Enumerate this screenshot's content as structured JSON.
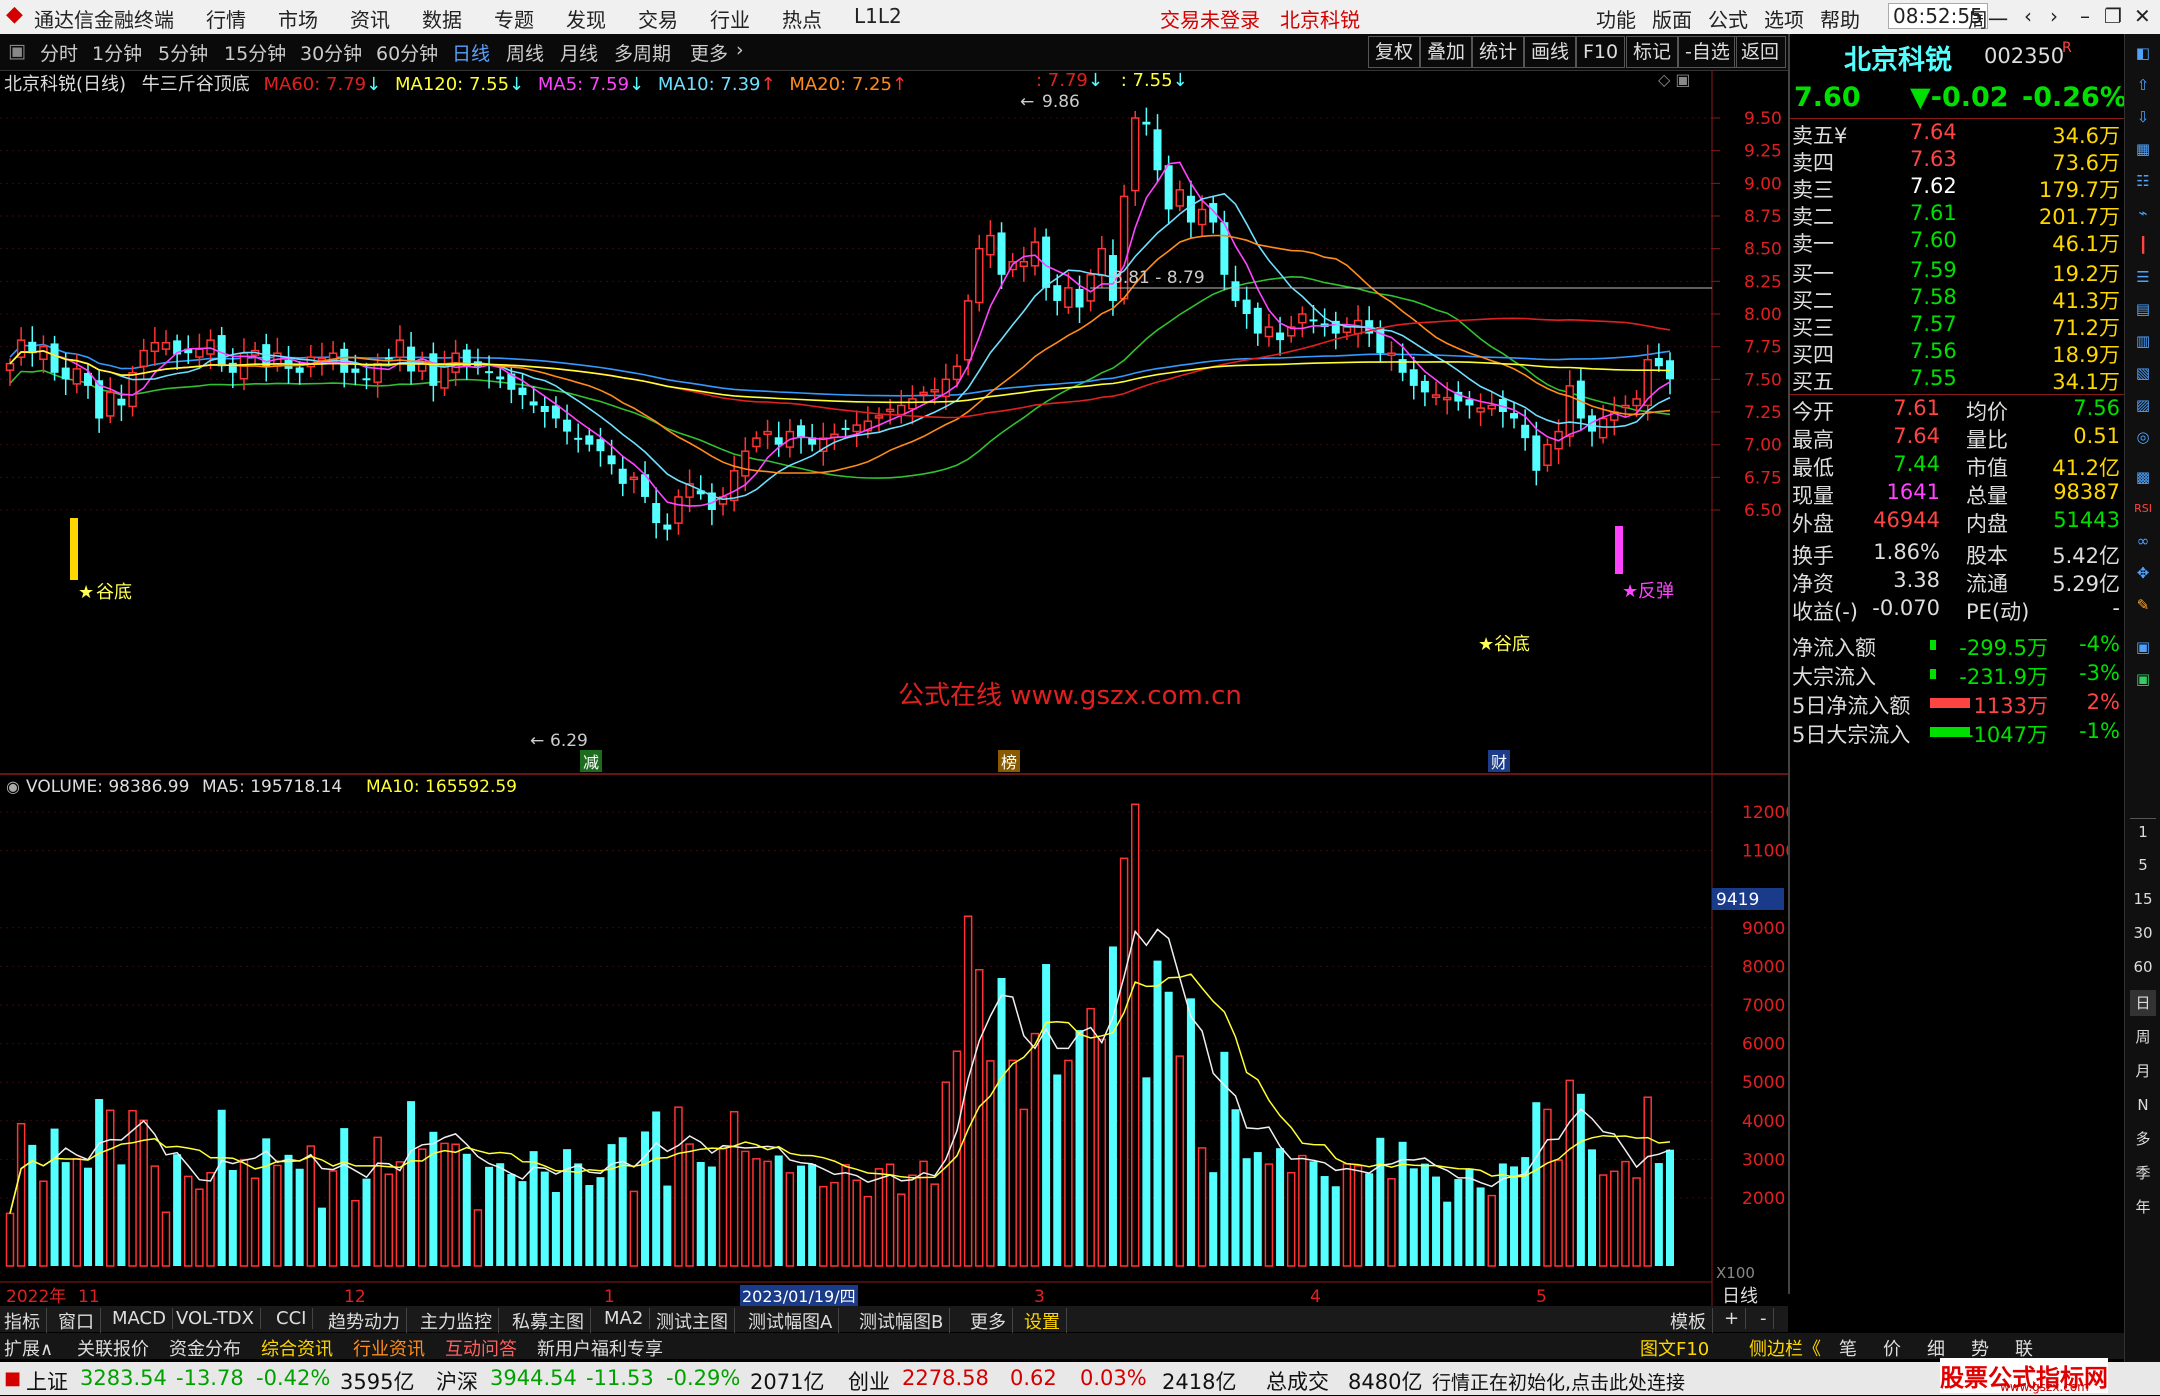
{
  "menu": {
    "app_title": "通达信金融终端",
    "items": [
      "行情",
      "市场",
      "资讯",
      "数据",
      "专题",
      "发现",
      "交易",
      "行业",
      "热点",
      "L1L2"
    ],
    "login_status": "交易未登录",
    "stock_title": "北京科锐",
    "right_items": [
      "功能",
      "版面",
      "公式",
      "选项",
      "帮助"
    ],
    "time": "08:52:55",
    "weekday": "周一"
  },
  "toolbar": {
    "periods": [
      "分时",
      "1分钟",
      "5分钟",
      "15分钟",
      "30分钟",
      "60分钟",
      "日线",
      "周线",
      "月线",
      "多周期",
      "更多"
    ],
    "selected": "日线",
    "actions": [
      "复权",
      "叠加",
      "统计",
      "画线",
      "F10",
      "标记",
      "-自选",
      "返回"
    ]
  },
  "chart_header": {
    "name": "北京科锐(日线)",
    "formula": "牛三斤谷顶底",
    "ma60": "MA60: 7.79",
    "ma120": "MA120: 7.55",
    "ma5": "MA5: 7.59",
    "ma10": "MA10: 7.39",
    "ma20": "MA20: 7.25",
    "top_a": ": 7.79",
    "top_b": ": 7.55"
  },
  "volume_header": {
    "volume": "VOLUME: 98386.99",
    "ma5": "MA5: 195718.14",
    "ma10": "MA10: 165592.59"
  },
  "chart_labels": {
    "high": "9.86",
    "low": "6.29",
    "range": "8.81 - 8.79",
    "gudi1": "谷底",
    "gudi2": "谷底",
    "fantan": "反弹",
    "watermark": "公式在线 www.gszx.com.cn",
    "badge_jian": "减",
    "badge_bang": "榜",
    "badge_cai": "财",
    "vol_badge": "9419",
    "vol_unit": "X100",
    "date_cursor": "2023/01/19/四",
    "period_label": "日线",
    "x_labels": [
      "2022年",
      "11",
      "12",
      "1",
      "3",
      "4",
      "5"
    ]
  },
  "colors": {
    "up": "#ff3333",
    "down": "#54ffff",
    "ma5": "#ff44ff",
    "ma10": "#6ee0ff",
    "ma20": "#ff8c1a",
    "ma60": "#e02020",
    "ma120": "#ffff33",
    "extra_green": "#30c030",
    "extra_blue": "#3399ff"
  },
  "chart_data": {
    "type": "candlestick",
    "price_axis": [
      9.5,
      9.25,
      9.0,
      8.75,
      8.5,
      8.25,
      8.0,
      7.75,
      7.5,
      7.25,
      7.0,
      6.75,
      6.5
    ],
    "volume_axis": [
      12000,
      11000,
      9000,
      8000,
      7000,
      6000,
      5000,
      4000,
      3000,
      2000
    ],
    "close": [
      7.62,
      7.8,
      7.7,
      7.75,
      7.55,
      7.5,
      7.58,
      7.45,
      7.2,
      7.4,
      7.3,
      7.55,
      7.72,
      7.78,
      7.78,
      7.69,
      7.7,
      7.73,
      7.8,
      7.6,
      7.55,
      7.7,
      7.72,
      7.6,
      7.7,
      7.58,
      7.55,
      7.67,
      7.66,
      7.7,
      7.55,
      7.55,
      7.5,
      7.62,
      7.66,
      7.8,
      7.56,
      7.65,
      7.45,
      7.6,
      7.7,
      7.6,
      7.6,
      7.55,
      7.5,
      7.42,
      7.38,
      7.3,
      7.25,
      7.2,
      7.1,
      7.05,
      7.0,
      6.95,
      6.85,
      6.7,
      6.75,
      6.6,
      6.4,
      6.35,
      6.6,
      6.7,
      6.62,
      6.5,
      6.6,
      6.8,
      6.95,
      7.05,
      7.1,
      7.0,
      7.1,
      7.05,
      7.0,
      7.05,
      7.08,
      7.12,
      7.15,
      7.18,
      7.22,
      7.27,
      7.3,
      7.35,
      7.4,
      7.42,
      7.5,
      7.6,
      8.1,
      8.5,
      8.6,
      8.3,
      8.4,
      8.4,
      8.55,
      8.2,
      8.1,
      8.2,
      8.05,
      8.3,
      8.5,
      8.1,
      8.9,
      9.5,
      9.45,
      9.1,
      8.8,
      8.95,
      8.7,
      8.8,
      8.7,
      8.3,
      8.1,
      8.0,
      7.85,
      7.9,
      7.8,
      7.9,
      8.0,
      7.95,
      7.9,
      7.85,
      7.9,
      7.95,
      7.85,
      7.7,
      7.7,
      7.55,
      7.45,
      7.4,
      7.38,
      7.36,
      7.33,
      7.3,
      7.28,
      7.3,
      7.25,
      7.2,
      7.05,
      6.8,
      7.0,
      7.1,
      7.45,
      7.2,
      7.1,
      7.2,
      7.25,
      7.3,
      7.35,
      7.65,
      7.6,
      7.5
    ]
  },
  "quote": {
    "name": "北京科锐",
    "code": "002350",
    "code_flag": "R",
    "price": "7.60",
    "change": "▼-0.02",
    "pct": "-0.26%",
    "asks": [
      {
        "label": "卖五¥",
        "price": "7.64",
        "vol": "34.6万"
      },
      {
        "label": "卖四",
        "price": "7.63",
        "vol": "73.6万"
      },
      {
        "label": "卖三",
        "price": "7.62",
        "vol": "179.7万"
      },
      {
        "label": "卖二",
        "price": "7.61",
        "vol": "201.7万"
      },
      {
        "label": "卖一",
        "price": "7.60",
        "vol": "46.1万"
      }
    ],
    "bids": [
      {
        "label": "买一",
        "price": "7.59",
        "vol": "19.2万"
      },
      {
        "label": "买二",
        "price": "7.58",
        "vol": "41.3万"
      },
      {
        "label": "买三",
        "price": "7.57",
        "vol": "71.2万"
      },
      {
        "label": "买四",
        "price": "7.56",
        "vol": "18.9万"
      },
      {
        "label": "买五",
        "price": "7.55",
        "vol": "34.1万"
      }
    ],
    "stats": [
      {
        "k1": "今开",
        "v1": "7.61",
        "k2": "均价",
        "v2": "7.56"
      },
      {
        "k1": "最高",
        "v1": "7.64",
        "k2": "量比",
        "v2": "0.51"
      },
      {
        "k1": "最低",
        "v1": "7.44",
        "k2": "市值",
        "v2": "41.2亿"
      },
      {
        "k1": "现量",
        "v1": "1641",
        "k2": "总量",
        "v2": "98387"
      },
      {
        "k1": "外盘",
        "v1": "46944",
        "k2": "内盘",
        "v2": "51443"
      }
    ],
    "fund": [
      {
        "k1": "换手",
        "v1": "1.86%",
        "k2": "股本",
        "v2": "5.42亿"
      },
      {
        "k1": "净资",
        "v1": "3.38",
        "k2": "流通",
        "v2": "5.29亿"
      },
      {
        "k1": "收益(-)",
        "v1": "-0.070",
        "k2": "PE(动)",
        "v2": "-"
      }
    ],
    "flows": [
      {
        "label": "净流入额",
        "value": "-299.5万",
        "pct": "-4%"
      },
      {
        "label": "大宗流入",
        "value": "-231.9万",
        "pct": "-3%"
      },
      {
        "label": "5日净流入额",
        "value": "1133万",
        "pct": "2%"
      },
      {
        "label": "5日大宗流入",
        "value": "-1047万",
        "pct": "-1%"
      }
    ]
  },
  "bottom_tabs": [
    "指标",
    "窗口",
    "MACD",
    "VOL-TDX",
    "CCI",
    "趋势动力",
    "主力监控",
    "私募主图",
    "MA2",
    "测试主图",
    "测试幅图A",
    "测试幅图B",
    "更多",
    "设置",
    "模板",
    "+",
    "-"
  ],
  "bottom_tabs2": [
    "扩展∧",
    "关联报价",
    "资金分布",
    "综合资讯",
    "行业资讯",
    "互动问答",
    "新用户福利专享"
  ],
  "bottom_tabs2_right": [
    "图文F10",
    "侧边栏《",
    "笔",
    "价",
    "细",
    "势",
    "联"
  ],
  "icon_strip": [
    "1",
    "5",
    "15",
    "30",
    "60",
    "日",
    "周",
    "月",
    "N",
    "多",
    "季",
    "年"
  ],
  "status": {
    "sh_label": "上证",
    "sh_val": "3283.54",
    "sh_chg": "-13.78",
    "sh_pct": "-0.42%",
    "sh_amt": "3595亿",
    "hs_label": "沪深",
    "hs_val": "3944.54",
    "hs_chg": "-11.53",
    "hs_pct": "-0.29%",
    "hs_amt": "2071亿",
    "cy_label": "创业",
    "cy_val": "2278.58",
    "cy_chg": "0.62",
    "cy_pct": "0.03%",
    "cy_amt": "2418亿",
    "total_label": "总成交",
    "total_val": "8480亿",
    "msg": "行情正在初始化,点击此处连接",
    "brand": "股票公式指标网",
    "brand_url": "www.gszx.com"
  }
}
